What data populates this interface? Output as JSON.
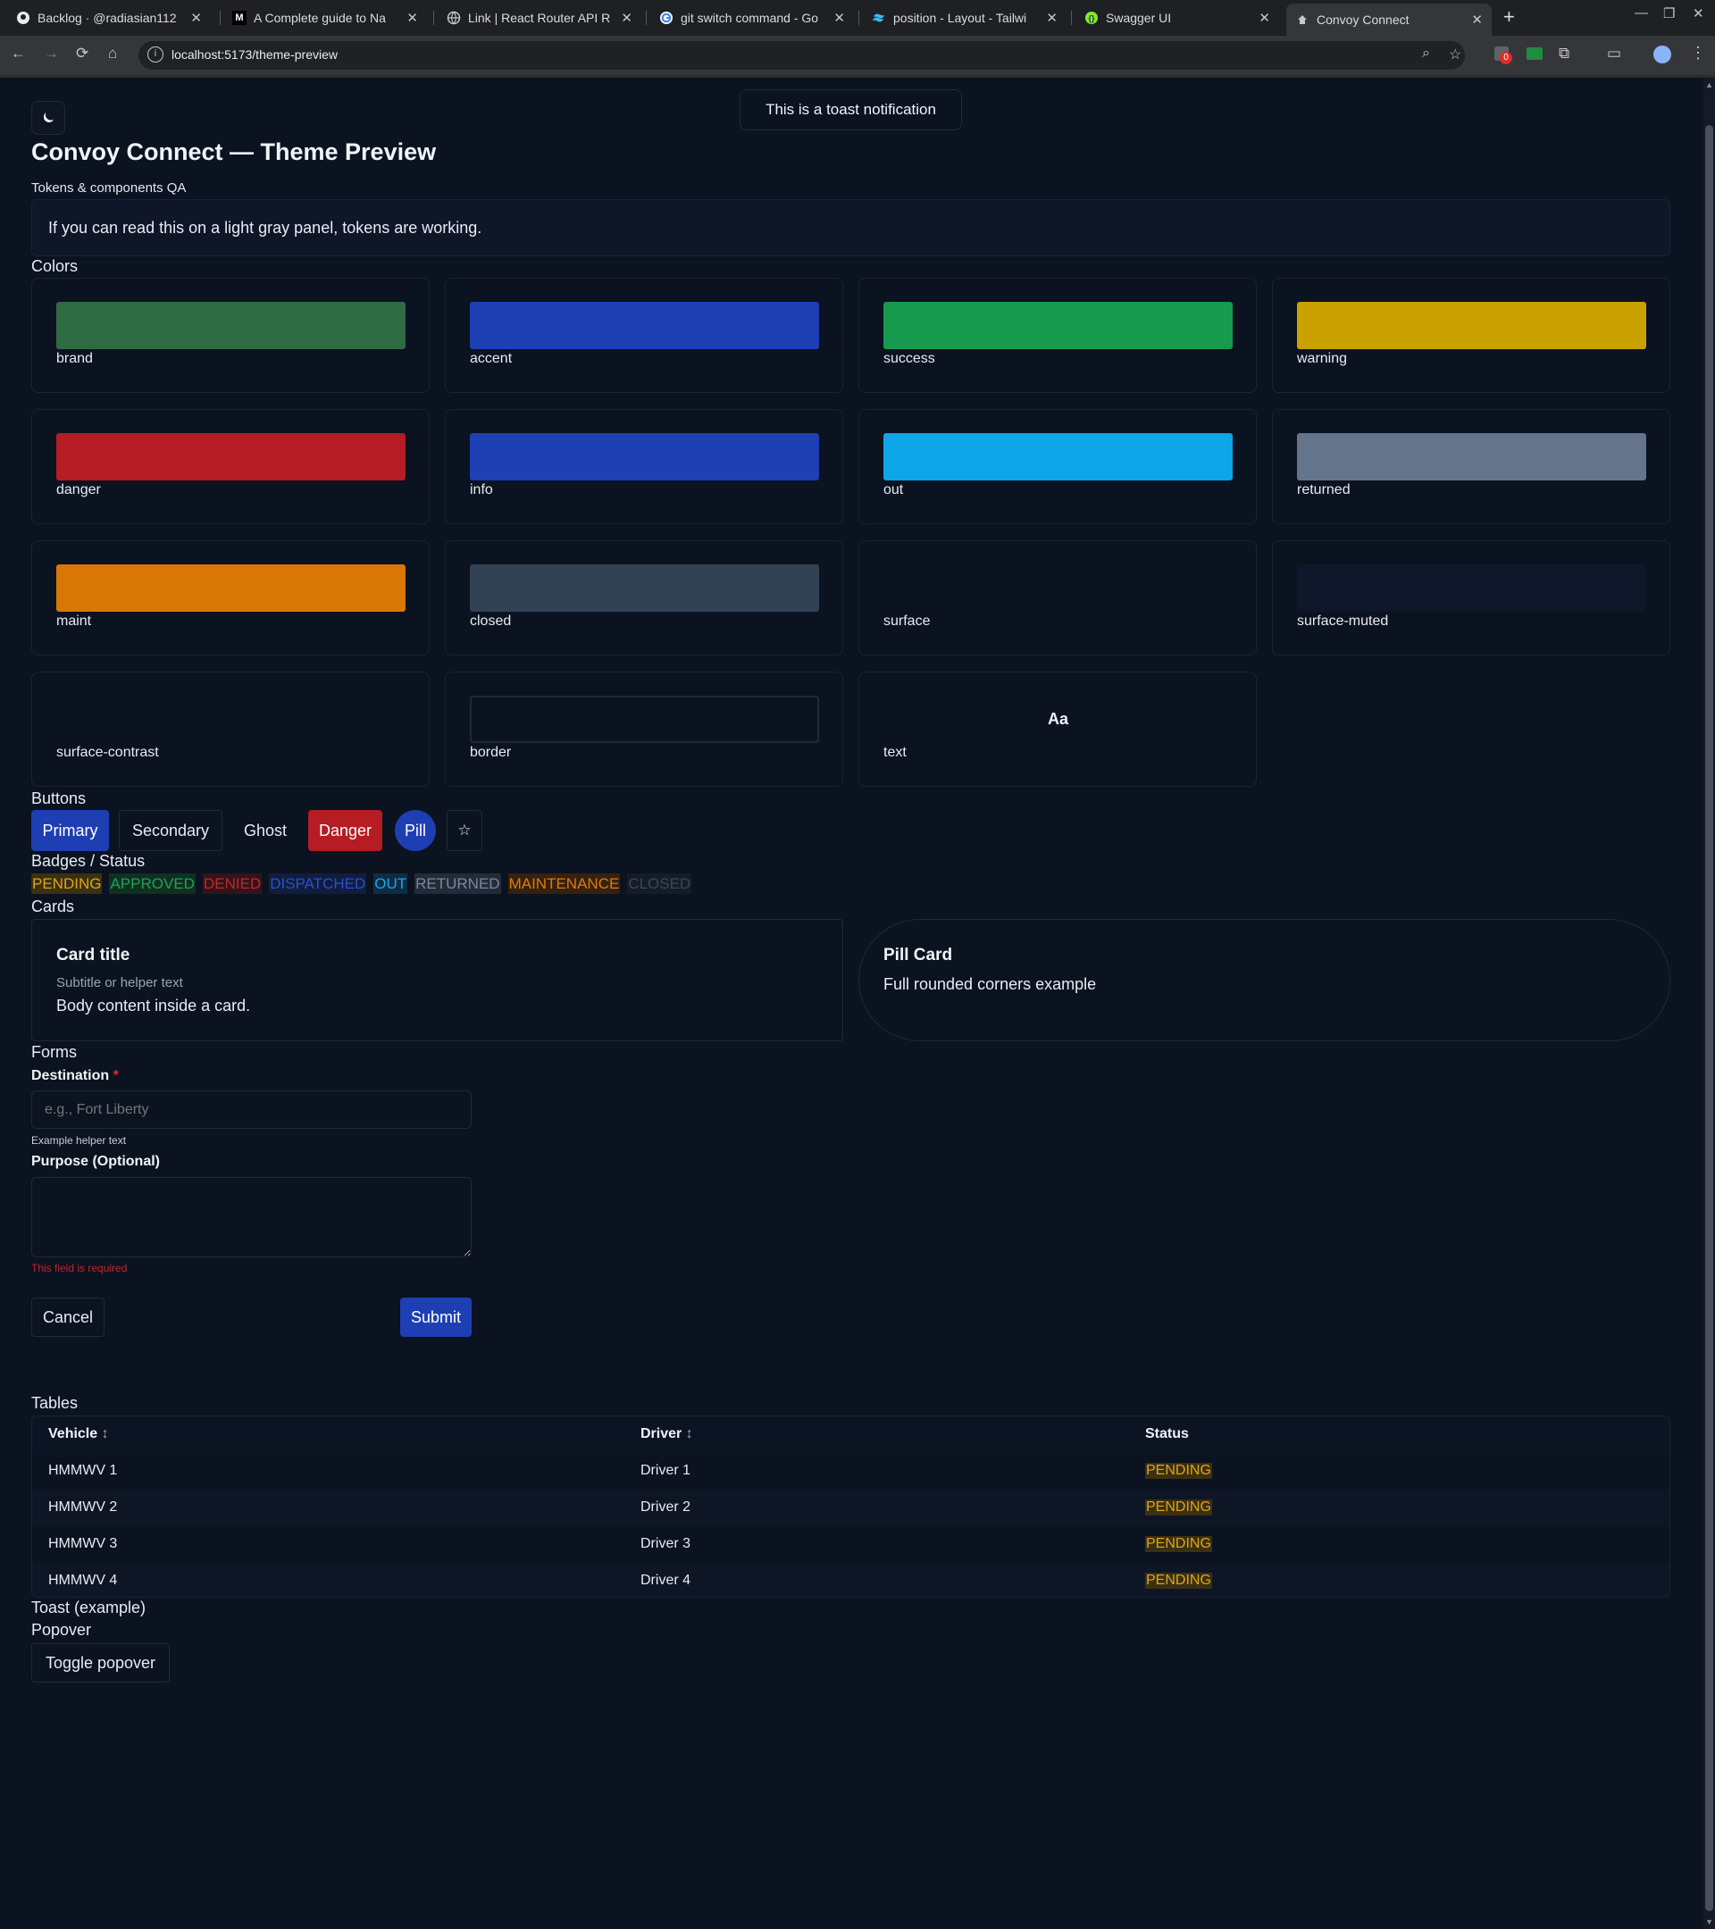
{
  "browser": {
    "tabs": [
      {
        "title": "Backlog · @radiasian112",
        "icon": "github-icon"
      },
      {
        "title": "A Complete guide to Na",
        "icon": "medium-icon"
      },
      {
        "title": "Link | React Router API R",
        "icon": "globe-icon"
      },
      {
        "title": "git switch command - Go",
        "icon": "google-icon"
      },
      {
        "title": "position - Layout - Tailwi",
        "icon": "tailwind-icon"
      },
      {
        "title": "Swagger UI",
        "icon": "swagger-icon"
      },
      {
        "title": "Convoy Connect",
        "icon": "app-icon",
        "active": true
      }
    ],
    "url": "localhost:5173/theme-preview",
    "extension_badge": "0"
  },
  "toast": {
    "text": "This is a toast notification"
  },
  "header": {
    "title": "Convoy Connect — Theme Preview",
    "subtitle": "Tokens & components QA",
    "notice": "If you can read this on a light gray panel, tokens are working."
  },
  "colors": {
    "heading": "Colors",
    "swatches": [
      {
        "name": "brand",
        "hex": "#2e6b42"
      },
      {
        "name": "accent",
        "hex": "#1f3fb5"
      },
      {
        "name": "success",
        "hex": "#169a4e"
      },
      {
        "name": "warning",
        "hex": "#c9a200"
      },
      {
        "name": "danger",
        "hex": "#b51c23"
      },
      {
        "name": "info",
        "hex": "#1f3fb5"
      },
      {
        "name": "out",
        "hex": "#0ea5e9"
      },
      {
        "name": "returned",
        "hex": "#64748b"
      },
      {
        "name": "maint",
        "hex": "#d97706"
      },
      {
        "name": "closed",
        "hex": "#334155"
      },
      {
        "name": "surface",
        "hex": "#0b1220"
      },
      {
        "name": "surface-muted",
        "hex": "#0f172a"
      },
      {
        "name": "surface-contrast",
        "hex": "#0b1220"
      },
      {
        "name": "border",
        "hex": "#1e2a3b"
      },
      {
        "name": "text",
        "hex": "#f1f5f9",
        "sample": "Aa"
      }
    ]
  },
  "buttons": {
    "heading": "Buttons",
    "primary": "Primary",
    "secondary": "Secondary",
    "ghost": "Ghost",
    "danger": "Danger",
    "pill": "Pill",
    "icon": "☆"
  },
  "badges": {
    "heading": "Badges / Status",
    "items": [
      {
        "label": "PENDING",
        "color": "#e0a419",
        "bg": "#3a3012"
      },
      {
        "label": "APPROVED",
        "color": "#1fa05a",
        "bg": "#11301f"
      },
      {
        "label": "DENIED",
        "color": "#c0262d",
        "bg": "#331419"
      },
      {
        "label": "DISPATCHED",
        "color": "#2a4fd0",
        "bg": "#111d3d"
      },
      {
        "label": "OUT",
        "color": "#1ba6e6",
        "bg": "#0f2c45"
      },
      {
        "label": "RETURNED",
        "color": "#7b8799",
        "bg": "#222b3a"
      },
      {
        "label": "MAINTENANCE",
        "color": "#e07a10",
        "bg": "#352110"
      },
      {
        "label": "CLOSED",
        "color": "#3c4658",
        "bg": "#141c2a"
      }
    ]
  },
  "cards": {
    "heading": "Cards",
    "card": {
      "title": "Card title",
      "subtitle": "Subtitle or helper text",
      "body": "Body content inside a card."
    },
    "pill_card": {
      "title": "Pill Card",
      "body": "Full rounded corners example"
    }
  },
  "forms": {
    "heading": "Forms",
    "destination": {
      "label": "Destination",
      "required_mark": "*",
      "placeholder": "e.g., Fort Liberty",
      "helper": "Example helper text"
    },
    "purpose": {
      "label": "Purpose (Optional)",
      "error": "This field is required"
    },
    "cancel": "Cancel",
    "submit": "Submit"
  },
  "tables": {
    "heading": "Tables",
    "columns": [
      "Vehicle",
      "Driver",
      "Status"
    ],
    "sort_icon": "↕",
    "rows": [
      {
        "vehicle": "HMMWV 1",
        "driver": "Driver 1",
        "status": "PENDING"
      },
      {
        "vehicle": "HMMWV 2",
        "driver": "Driver 2",
        "status": "PENDING"
      },
      {
        "vehicle": "HMMWV 3",
        "driver": "Driver 3",
        "status": "PENDING"
      },
      {
        "vehicle": "HMMWV 4",
        "driver": "Driver 4",
        "status": "PENDING"
      }
    ]
  },
  "toast_example": {
    "heading": "Toast (example)"
  },
  "popover": {
    "heading": "Popover",
    "toggle": "Toggle popover"
  }
}
